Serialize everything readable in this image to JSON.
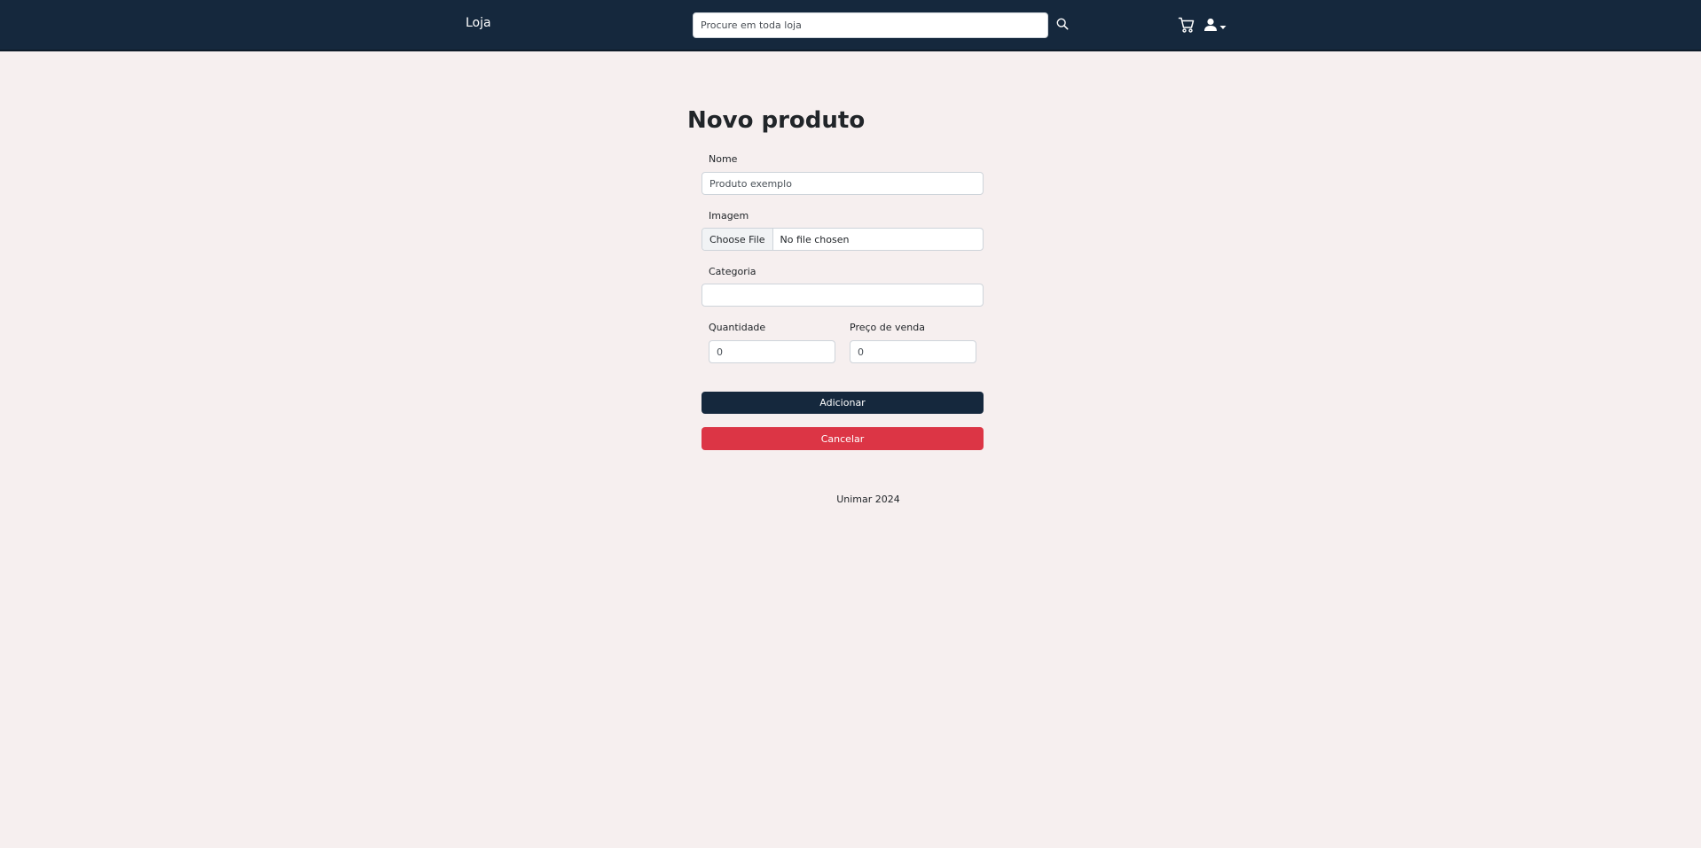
{
  "header": {
    "brand": "Loja",
    "search_placeholder": "Procure em toda loja",
    "icons": [
      "search-icon",
      "cart-icon",
      "user-icon",
      "caret-down-icon"
    ]
  },
  "form": {
    "title": "Novo produto",
    "nome_label": "Nome",
    "nome_value": "Produto exemplo",
    "imagem_label": "Imagem",
    "file_button_label": "Choose File",
    "file_status": "No file chosen",
    "categoria_label": "Categoria",
    "categoria_value": "",
    "quantidade_label": "Quantidade",
    "quantidade_value": "0",
    "preco_label": "Preço de venda",
    "preco_value": "0",
    "submit_label": "Adicionar",
    "cancel_label": "Cancelar"
  },
  "footer": {
    "text": "Unimar 2024"
  },
  "colors": {
    "header_bg": "#15283d",
    "page_bg": "#f6efef",
    "primary": "#15283d",
    "danger": "#dc3545"
  }
}
